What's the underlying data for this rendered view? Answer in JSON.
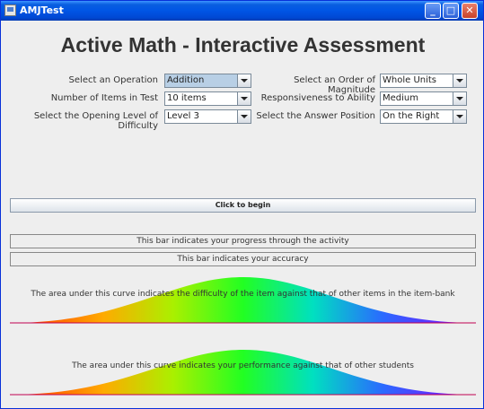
{
  "window": {
    "title": "AMJTest",
    "minimize": "_",
    "maximize": "□",
    "close": "✕"
  },
  "heading": "Active Math - Interactive Assessment",
  "settings": {
    "operation": {
      "label": "Select an Operation",
      "value": "Addition"
    },
    "items": {
      "label": "Number of Items in Test",
      "value": "10 items"
    },
    "difficulty": {
      "label": "Select the Opening Level of Difficulty",
      "value": "Level 3"
    },
    "magnitude": {
      "label": "Select an Order of Magnitude",
      "value": "Whole Units"
    },
    "responsiveness": {
      "label": "Responsiveness to Ability",
      "value": "Medium"
    },
    "answer_position": {
      "label": "Select the Answer Position",
      "value": "On the Right"
    }
  },
  "begin_button": "Click to begin",
  "progress_bar": {
    "label": "This bar indicates your progress through the activity",
    "value": 0
  },
  "accuracy_bar": {
    "label": "This bar indicates your accuracy",
    "value": 0
  },
  "difficulty_curve": "The area under this curve indicates the difficulty of the item against that of other items in the item-bank",
  "performance_curve": "The area under this curve indicates your performance against that of other students"
}
